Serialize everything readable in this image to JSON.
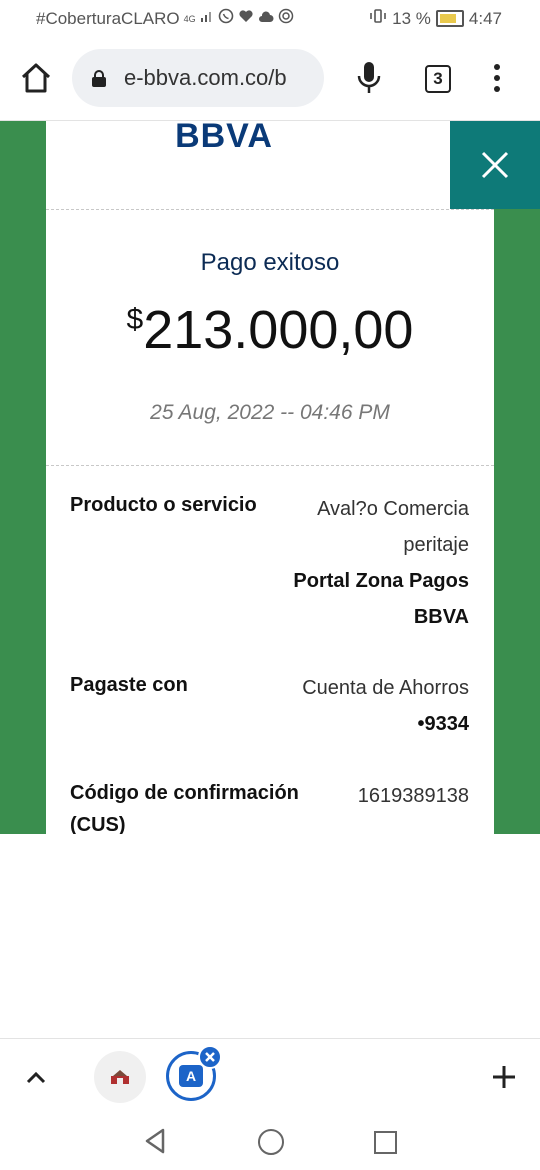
{
  "status_bar": {
    "carrier": "#CoberturaCLARO",
    "network": "4G",
    "battery": "13 %",
    "time": "4:47"
  },
  "browser": {
    "url": "e-bbva.com.co/b",
    "tab_count": "3"
  },
  "receipt": {
    "brand": "BBVA",
    "title": "Pago exitoso",
    "currency": "$",
    "amount": "213.000,00",
    "date": "25 Aug, 2022 -- 04:46 PM",
    "rows": [
      {
        "label": "Producto o servicio",
        "value_lines": [
          "Aval?o Comercia",
          "peritaje"
        ],
        "value_bold_lines": [
          "Portal Zona Pagos",
          "BBVA"
        ]
      },
      {
        "label": "Pagaste con",
        "value_lines": [
          "Cuenta de Ahorros"
        ],
        "value_bold_lines": [
          "•9334"
        ]
      },
      {
        "label_lines": [
          "Código de confirmación",
          "(CUS)"
        ],
        "value_lines": [
          "1619389138"
        ]
      }
    ]
  },
  "toolbar": {
    "active_tab_letter": "A"
  },
  "colors": {
    "green_background": "#3a8e4e",
    "close_teal": "#0e7a78",
    "brand_blue": "#0a3a78",
    "accent_blue": "#1c64c8"
  }
}
